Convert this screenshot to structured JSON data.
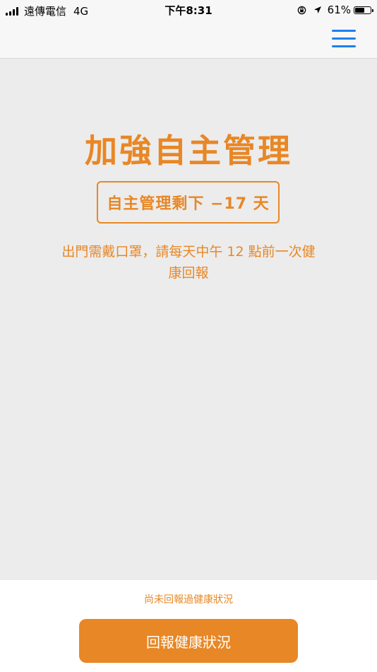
{
  "status_bar": {
    "carrier": "遠傳電信",
    "network": "4G",
    "time": "下午8:31",
    "battery_percent": "61%",
    "battery_level": 0.61,
    "icons": [
      "signal-icon",
      "rotation-lock-icon",
      "location-arrow-icon",
      "battery-icon"
    ]
  },
  "nav": {
    "menu_icon": "hamburger-menu-icon",
    "accent_color": "#1e7ff0"
  },
  "main": {
    "title": "加強自主管理",
    "days_badge": "自主管理剩下 −17 天",
    "instructions": "出門需戴口罩，請每天中午 12 點前一次健康回報",
    "accent_color": "#e88725"
  },
  "footer": {
    "report_status": "尚未回報過健康狀況",
    "report_button_label": "回報健康狀況"
  }
}
